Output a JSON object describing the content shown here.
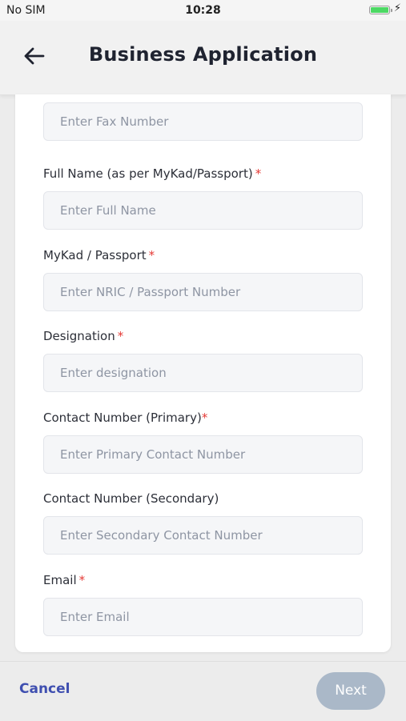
{
  "status": {
    "carrier": "No SIM",
    "time": "10:28",
    "battery_level": 1.0
  },
  "header": {
    "title": "Business Application",
    "back_icon": "arrow-left-icon"
  },
  "form": {
    "fax": {
      "placeholder": "Enter Fax Number"
    },
    "full_name": {
      "label": "Full Name (as per MyKad/Passport)",
      "required": "*",
      "placeholder": "Enter Full Name"
    },
    "mykad": {
      "label": "MyKad / Passport",
      "required": "*",
      "placeholder": "Enter NRIC / Passport Number"
    },
    "designation": {
      "label": "Designation",
      "required": "*",
      "placeholder": "Enter designation"
    },
    "contact_primary": {
      "label": "Contact Number (Primary)",
      "required": "*",
      "placeholder": "Enter Primary Contact Number"
    },
    "contact_secondary": {
      "label": "Contact Number (Secondary)",
      "placeholder": "Enter Secondary Contact Number"
    },
    "email": {
      "label": "Email",
      "required": "*",
      "placeholder": "Enter Email"
    }
  },
  "footer": {
    "cancel_label": "Cancel",
    "next_label": "Next"
  },
  "colors": {
    "accent": "#3f4fb0",
    "required": "#e53935",
    "next_disabled": "#aab8c8",
    "battery": "#4cd964"
  }
}
